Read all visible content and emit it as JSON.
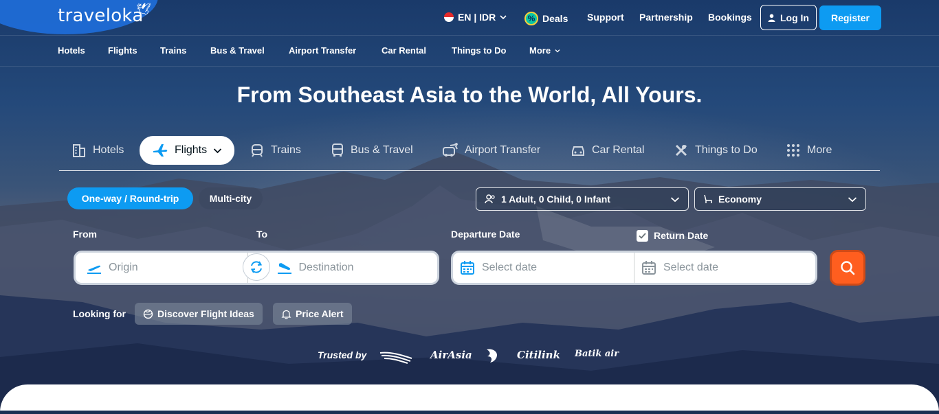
{
  "header": {
    "logo": "traveloka",
    "language": "EN | IDR",
    "deals": "Deals",
    "support": "Support",
    "partnership": "Partnership",
    "bookings": "Bookings",
    "login": "Log In",
    "register": "Register"
  },
  "subnav": [
    "Hotels",
    "Flights",
    "Trains",
    "Bus & Travel",
    "Airport Transfer",
    "Car Rental",
    "Things to Do",
    "More"
  ],
  "hero": {
    "title": "From Southeast Asia to the World, All Yours."
  },
  "tabs": [
    {
      "label": "Hotels",
      "icon": "hotel-icon"
    },
    {
      "label": "Flights",
      "icon": "airplane-icon",
      "active": true
    },
    {
      "label": "Trains",
      "icon": "train-icon"
    },
    {
      "label": "Bus & Travel",
      "icon": "bus-icon"
    },
    {
      "label": "Airport Transfer",
      "icon": "airport-transfer-icon"
    },
    {
      "label": "Car Rental",
      "icon": "car-icon"
    },
    {
      "label": "Things to Do",
      "icon": "things-to-do-icon"
    },
    {
      "label": "More",
      "icon": "grid-icon"
    }
  ],
  "trip_types": {
    "oneway": "One-way / Round-trip",
    "multicity": "Multi-city"
  },
  "passengers": "1 Adult, 0 Child, 0 Infant",
  "seat_class": "Economy",
  "form": {
    "from_label": "From",
    "to_label": "To",
    "departure_label": "Departure Date",
    "return_label": "Return Date",
    "return_checked": true,
    "origin_placeholder": "Origin",
    "destination_placeholder": "Destination",
    "departure_placeholder": "Select date",
    "return_placeholder": "Select date"
  },
  "looking_for": {
    "label": "Looking for",
    "discover": "Discover Flight Ideas",
    "price_alert": "Price Alert"
  },
  "trusted": {
    "label": "Trusted by",
    "airlines": [
      "AirAsia",
      "Citilink",
      "Batik air"
    ]
  },
  "colors": {
    "primary": "#0d9bf2",
    "search": "#ff5e1f",
    "text_dark": "#03121a"
  }
}
